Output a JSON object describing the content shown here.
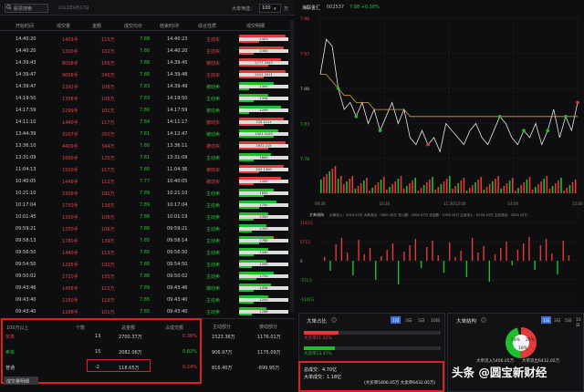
{
  "toolbar": {
    "search_placeholder": "股票搜索",
    "date": "2022年8月17日",
    "filter_label": "大单筛选：",
    "filter_value": "100",
    "filter_unit": "万"
  },
  "tick_table": {
    "headers": [
      "开始时间",
      "成交量",
      "金额",
      "成交均价",
      "结束时间",
      "综合性质",
      "成交明细"
    ],
    "rows": [
      {
        "start": "14:40:20",
        "vol": "1403手",
        "amt": "115万",
        "avg": "7.88",
        "end": "14:40:23",
        "type": "主动买",
        "dir": "buy",
        "mid": "1403",
        "top": 0.95,
        "bot": 0.4
      },
      {
        "start": "14:40:20",
        "vol": "1300手",
        "amt": "102万",
        "avg": "7.80",
        "end": "14:40:20",
        "type": "主动买",
        "dir": "buy",
        "mid": "1300",
        "top": 0.9,
        "bot": 0.3
      },
      {
        "start": "14:39:43",
        "vol": "8008手",
        "amt": "165万",
        "avg": "7.86",
        "end": "14:39:45",
        "type": "被动买",
        "dir": "buy",
        "mid": "2777  3343",
        "top": 0.85,
        "bot": 0.6
      },
      {
        "start": "14:39:47",
        "vol": "9009手",
        "amt": "245万",
        "avg": "7.88",
        "end": "14:39:48",
        "type": "主动买",
        "dir": "buy",
        "mid": "3101  2011",
        "top": 0.95,
        "bot": 0.5
      },
      {
        "start": "14:39:47",
        "vol": "1392手",
        "amt": "108万",
        "avg": "7.83",
        "end": "14:39:49",
        "type": "被动卖",
        "dir": "sell",
        "mid": "1392",
        "top": 0.7,
        "bot": 0.2
      },
      {
        "start": "14:19:50",
        "vol": "1358手",
        "amt": "106万",
        "avg": "7.83",
        "end": "14:19:50",
        "type": "主动卖",
        "dir": "sell",
        "mid": "1358",
        "top": 0.6,
        "bot": 0.3
      },
      {
        "start": "14:17:59",
        "vol": "1299手",
        "amt": "101万",
        "avg": "7.80",
        "end": "14:17:59",
        "type": "被动卖",
        "dir": "sell",
        "mid": "1299",
        "top": 0.85,
        "bot": 0.2
      },
      {
        "start": "14:11:10",
        "vol": "1440手",
        "amt": "117万",
        "avg": "7.84",
        "end": "14:11:17",
        "type": "被动买",
        "dir": "buy",
        "mid": "725  2111",
        "top": 0.9,
        "bot": 0.5
      },
      {
        "start": "13:44:39",
        "vol": "3207手",
        "amt": "250万",
        "avg": "7.81",
        "end": "14:12:47",
        "type": "被动卖",
        "dir": "sell",
        "mid": "1001  3103",
        "top": 0.8,
        "bot": 0.7
      },
      {
        "start": "13:36:10",
        "vol": "4409手",
        "amt": "344万",
        "avg": "7.80",
        "end": "13:36:11",
        "type": "被动买",
        "dir": "buy",
        "mid": "2872  215",
        "top": 0.95,
        "bot": 0.6
      },
      {
        "start": "13:31:09",
        "vol": "1600手",
        "amt": "125万",
        "avg": "7.81",
        "end": "13:31:09",
        "type": "主动卖",
        "dir": "sell",
        "mid": "1600",
        "top": 0.65,
        "bot": 0.3
      },
      {
        "start": "11:04:13",
        "vol": "1500手",
        "amt": "117万",
        "avg": "7.80",
        "end": "11:04:36",
        "type": "被动买",
        "dir": "buy",
        "mid": "200  1300",
        "top": 0.9,
        "bot": 0.4
      },
      {
        "start": "10:40:05",
        "vol": "1449手",
        "amt": "112万",
        "avg": "7.77",
        "end": "10:40:05",
        "type": "被动买",
        "dir": "buy",
        "mid": "1449",
        "top": 0.85,
        "bot": 0.3
      },
      {
        "start": "10:21:10",
        "vol": "2309手",
        "amt": "182万",
        "avg": "7.89",
        "end": "10:21:10",
        "type": "主动卖",
        "dir": "sell",
        "mid": "1832",
        "top": 0.7,
        "bot": 0.5
      },
      {
        "start": "10:17:04",
        "vol": "1750手",
        "amt": "138万",
        "avg": "7.89",
        "end": "10:17:04",
        "type": "主动卖",
        "dir": "sell",
        "mid": "1750",
        "top": 0.75,
        "bot": 0.4
      },
      {
        "start": "10:01:45",
        "vol": "1350手",
        "amt": "106万",
        "avg": "7.86",
        "end": "10:01:19",
        "type": "主动卖",
        "dir": "sell",
        "mid": "1350",
        "top": 0.6,
        "bot": 0.3
      },
      {
        "start": "09:59:21",
        "vol": "1350手",
        "amt": "106万",
        "avg": "7.86",
        "end": "09:59:21",
        "type": "主动卖",
        "dir": "sell",
        "mid": "1350",
        "top": 0.55,
        "bot": 0.25
      },
      {
        "start": "09:58:13",
        "vol": "1780手",
        "amt": "139万",
        "avg": "7.85",
        "end": "09:58:14",
        "type": "主动卖",
        "dir": "sell",
        "mid": "1780",
        "top": 0.7,
        "bot": 0.4
      },
      {
        "start": "09:56:50",
        "vol": "1440手",
        "amt": "113万",
        "avg": "7.85",
        "end": "09:56:50",
        "type": "主动卖",
        "dir": "sell",
        "mid": "1440",
        "top": 0.6,
        "bot": 0.3
      },
      {
        "start": "09:54:50",
        "vol": "1295手",
        "amt": "102万",
        "avg": "7.88",
        "end": "09:54:50",
        "type": "主动卖",
        "dir": "sell",
        "mid": "1295",
        "top": 0.55,
        "bot": 0.25
      },
      {
        "start": "09:50:02",
        "vol": "1720手",
        "amt": "135万",
        "avg": "7.86",
        "end": "09:50:02",
        "type": "主动卖",
        "dir": "sell",
        "mid": "1720",
        "top": 0.7,
        "bot": 0.35
      },
      {
        "start": "09:43:46",
        "vol": "1458手",
        "amt": "115万",
        "avg": "7.89",
        "end": "09:43:46",
        "type": "被动卖",
        "dir": "sell",
        "mid": "1458",
        "top": 0.65,
        "bot": 0.3
      },
      {
        "start": "09:43:40",
        "vol": "1250手",
        "amt": "119万",
        "avg": "7.85",
        "end": "09:43:40",
        "type": "主动卖",
        "dir": "sell",
        "mid": "1250",
        "top": 0.6,
        "bot": 0.3
      },
      {
        "start": "09:43:40",
        "vol": "1288手",
        "amt": "101万",
        "avg": "7.85",
        "end": "09:43:40",
        "type": "主动卖",
        "dir": "sell",
        "mid": "1288",
        "top": 0.55,
        "bot": 0.25
      }
    ]
  },
  "summary": {
    "headers": [
      "100万以上",
      "个数",
      "总金额",
      "占成交额",
      "主动部分",
      "被动部分"
    ],
    "rows": [
      {
        "label": "买单",
        "count": "13",
        "amount": "2700.37万",
        "pct": "0.36%",
        "active": "1523.36万",
        "passive": "1176.01万",
        "color": "#e04444"
      },
      {
        "label": "卖单",
        "count": "15",
        "amount": "2082.06万",
        "pct": "0.82%",
        "active": "906.97万",
        "passive": "1175.09万",
        "color": "#26c431"
      },
      {
        "label": "普通",
        "count": "-2",
        "amount": "118.65万",
        "pct": "0.24%",
        "active": "816.40万",
        "passive": "-699.95万",
        "color": "#d0d0d0"
      }
    ],
    "detail_tab": "成交量明细"
  },
  "chart": {
    "title": "海联金汇",
    "code": "002537",
    "price": "7.88 +0.38%",
    "y_labels": [
      "7.98",
      "7.93",
      "7.88",
      "7.83",
      "7.78"
    ],
    "x_labels": [
      "09:30",
      "10:30",
      "11:30/13:00",
      "14:00",
      "15:00"
    ],
    "vol_label": "大单流向",
    "vol_info": "大单流入：5204.43万  大单流出：2600.36万  流入额：2604.07万  流出额：1208.33万  主动流入：6200.43万  主动流出：3305.45万",
    "flow_axis": [
      "1141万",
      "571万",
      "0",
      "-571万",
      "-1141万"
    ],
    "price_series": [
      7.9,
      7.95,
      7.94,
      7.88,
      7.85,
      7.86,
      7.84,
      7.86,
      7.83,
      7.85,
      7.82,
      7.84,
      7.86,
      7.83,
      7.85,
      7.81,
      7.8,
      7.82,
      7.8,
      7.81,
      7.79,
      7.83,
      7.82,
      7.81,
      7.8,
      7.82,
      7.83,
      7.81,
      7.8,
      7.82,
      7.84,
      7.83,
      7.81,
      7.8,
      7.82,
      7.81,
      7.83,
      7.8,
      7.82,
      7.85,
      7.81,
      7.84,
      7.82,
      7.86
    ],
    "avg_series": [
      7.9,
      7.9,
      7.89,
      7.88,
      7.87,
      7.87,
      7.86,
      7.86,
      7.86,
      7.85,
      7.85,
      7.85,
      7.85,
      7.85,
      7.85,
      7.84,
      7.84,
      7.84,
      7.84,
      7.84,
      7.84,
      7.84,
      7.84,
      7.84,
      7.84,
      7.84,
      7.84,
      7.84,
      7.84,
      7.84,
      7.84,
      7.84,
      7.84,
      7.84,
      7.84,
      7.84,
      7.84,
      7.84,
      7.84,
      7.84,
      7.84,
      7.84,
      7.84,
      7.84
    ]
  },
  "ratio": {
    "title": "大单占比",
    "tabs": [
      "1日",
      "3日",
      "5日",
      "10日"
    ],
    "buy_label": "大买单11.32%",
    "buy_pct": 0.2525,
    "sell_label": "大卖单13.47%",
    "sell_pct": 0.2262,
    "total": "总成交：4.70亿",
    "big_total": "大单成交：1.18亿",
    "detail": "(大买单5406.05万 大卖单6432.05万)"
  },
  "structure": {
    "title": "大单结构",
    "tabs": [
      "1日",
      "3日",
      "5日",
      "10日"
    ],
    "slice_red": "20%",
    "slice_green": "18%",
    "slice_rest": "18%",
    "buy_in": "大单流入5406.05万",
    "sell_out": "大单流出6432.05万"
  },
  "watermark": "头条 @圆宝新财经"
}
